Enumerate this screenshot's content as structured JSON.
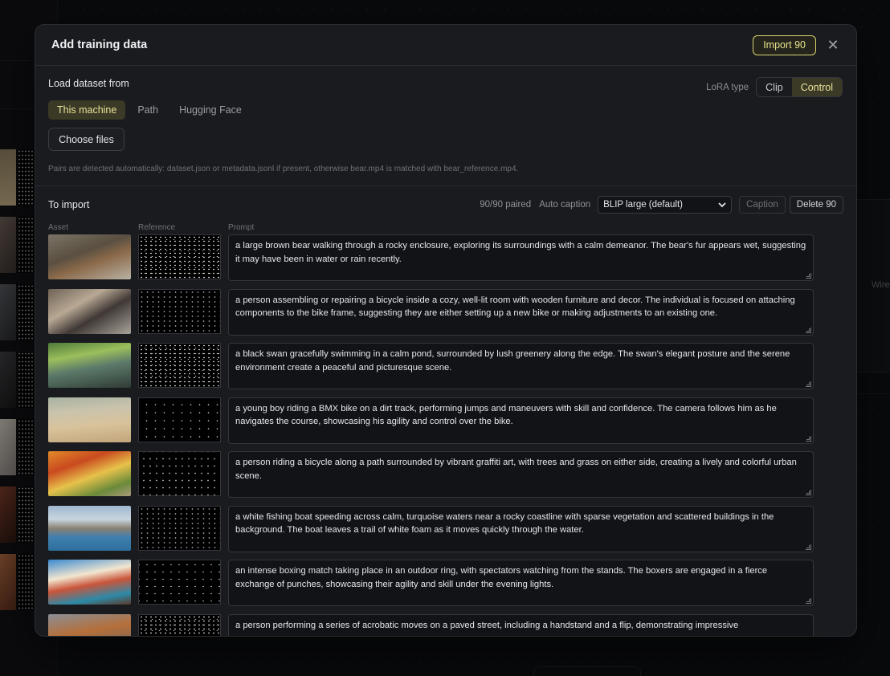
{
  "modal": {
    "title": "Add training data",
    "import_label": "Import 90",
    "close_glyph": "✕"
  },
  "load": {
    "title": "Load dataset from",
    "lora_label": "LoRA type",
    "lora_options": [
      "Clip",
      "Control"
    ],
    "lora_selected": "Control",
    "sources": [
      "This machine",
      "Path",
      "Hugging Face"
    ],
    "source_selected": "This machine",
    "choose_files_label": "Choose files",
    "hint": "Pairs are detected automatically: dataset.json or metadata.jsonl if present, otherwise bear.mp4 is matched with bear_reference.mp4."
  },
  "to_import": {
    "title": "To import",
    "paired_status": "90/90 paired",
    "auto_caption_label": "Auto caption",
    "caption_model": "BLIP large (default)",
    "caption_button": "Caption",
    "delete_button": "Delete 90",
    "columns": [
      "Asset",
      "Reference",
      "Prompt"
    ],
    "rows": [
      {
        "prompt": "a large brown bear walking through a rocky enclosure, exploring its surroundings with a calm demeanor. The bear's fur appears wet, suggesting it may have been in water or rain recently."
      },
      {
        "prompt": "a person assembling or repairing a bicycle inside a cozy, well-lit room with wooden furniture and decor. The individual is focused on attaching components to the bike frame, suggesting they are either setting up a new bike or making adjustments to an existing one."
      },
      {
        "prompt": "a black swan gracefully swimming in a calm pond, surrounded by lush greenery along the edge. The swan's elegant posture and the serene environment create a peaceful and picturesque scene."
      },
      {
        "prompt": "a young boy riding a BMX bike on a dirt track, performing jumps and maneuvers with skill and confidence. The camera follows him as he navigates the course, showcasing his agility and control over the bike."
      },
      {
        "prompt": "a person riding a bicycle along a path surrounded by vibrant graffiti art, with trees and grass on either side, creating a lively and colorful urban scene."
      },
      {
        "prompt": "a white fishing boat speeding across calm, turquoise waters near a rocky coastline with sparse vegetation and scattered buildings in the background. The boat leaves a trail of white foam as it moves quickly through the water."
      },
      {
        "prompt": "an intense boxing match taking place in an outdoor ring, with spectators watching from the stands. The boxers are engaged in a fierce exchange of punches, showcasing their agility and skill under the evening lights."
      },
      {
        "prompt": "a person performing a series of acrobatic moves on a paved street, including a handstand and a flip, demonstrating impressive"
      }
    ]
  },
  "background": {
    "right_panel_text": "Wire"
  },
  "colors": {
    "accent": "#e6e28a",
    "accent_bg": "#3b3a26",
    "modal_bg": "#1a1b1f"
  }
}
